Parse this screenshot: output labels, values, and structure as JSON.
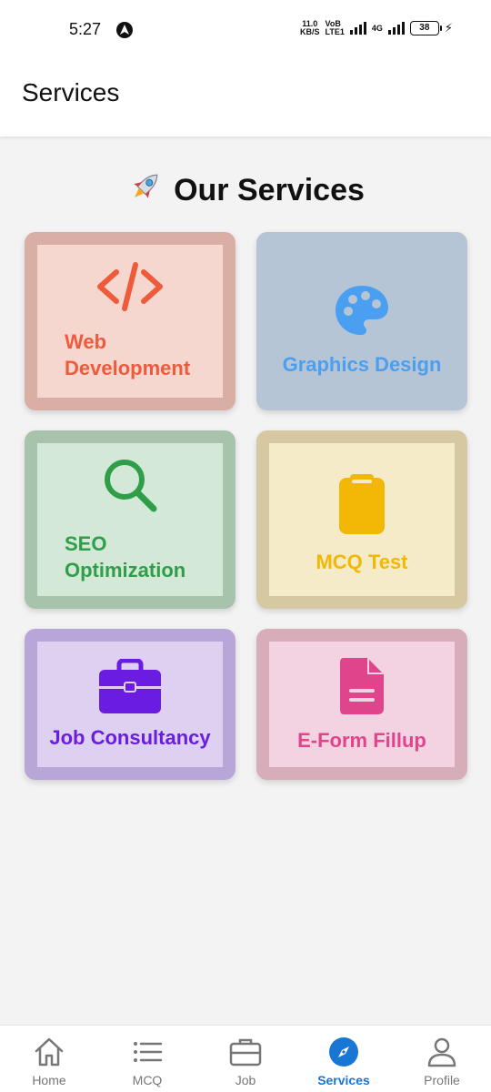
{
  "status_bar": {
    "time": "5:27",
    "net_speed_value": "11.0",
    "net_speed_unit": "KB/S",
    "volte_top": "VoB",
    "volte_bottom": "LTE1",
    "network": "4G",
    "battery": "38"
  },
  "app_bar": {
    "title": "Services"
  },
  "heading": {
    "title": "Our Services",
    "icon": "rocket-icon"
  },
  "services": [
    {
      "label": "Web Development",
      "label_line1": "Web",
      "label_line2": "Development",
      "icon": "code-icon",
      "color": "#ee5a3a",
      "bg": "#f6d7d0",
      "border": "#d9aea5"
    },
    {
      "label": "Graphics Design",
      "icon": "palette-icon",
      "color": "#4a9ff0",
      "bg": "#b5c5d6",
      "border": "#b5c5d6"
    },
    {
      "label": "SEO Optimization",
      "label_line1": "SEO",
      "label_line2": "Optimization",
      "icon": "search-icon",
      "color": "#2e9e48",
      "bg": "#d3e8d6",
      "border": "#a8c3ac"
    },
    {
      "label": "MCQ Test",
      "icon": "clipboard-icon",
      "color": "#f3b806",
      "bg": "#f5ebc8",
      "border": "#d6c9a2"
    },
    {
      "label": "Job Consultancy",
      "icon": "briefcase-icon",
      "color": "#6a1ce0",
      "bg": "#ddd0f1",
      "border": "#b9a6d8"
    },
    {
      "label": "E-Form Fillup",
      "icon": "document-icon",
      "color": "#e0458c",
      "bg": "#f3d3e1",
      "border": "#d6adb9"
    }
  ],
  "bottom_nav": {
    "items": [
      {
        "label": "Home",
        "icon": "home-icon"
      },
      {
        "label": "MCQ",
        "icon": "list-icon"
      },
      {
        "label": "Job",
        "icon": "briefcase-icon"
      },
      {
        "label": "Services",
        "icon": "compass-icon",
        "active": true
      },
      {
        "label": "Profile",
        "icon": "person-icon"
      }
    ],
    "active_color": "#1976d2"
  }
}
